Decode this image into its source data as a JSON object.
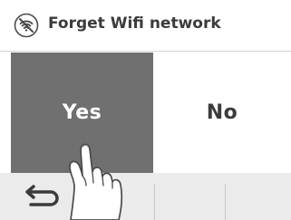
{
  "header": {
    "title": "Forget Wifi network",
    "icon": "wifi-off-icon"
  },
  "dialog": {
    "yes_label": "Yes",
    "no_label": "No"
  },
  "bottom_bar": {
    "back_icon": "back-arrow-icon"
  },
  "colors": {
    "yes_background": "#707070",
    "bottom_bar": "#ebebeb",
    "text": "#3b3b3b"
  }
}
